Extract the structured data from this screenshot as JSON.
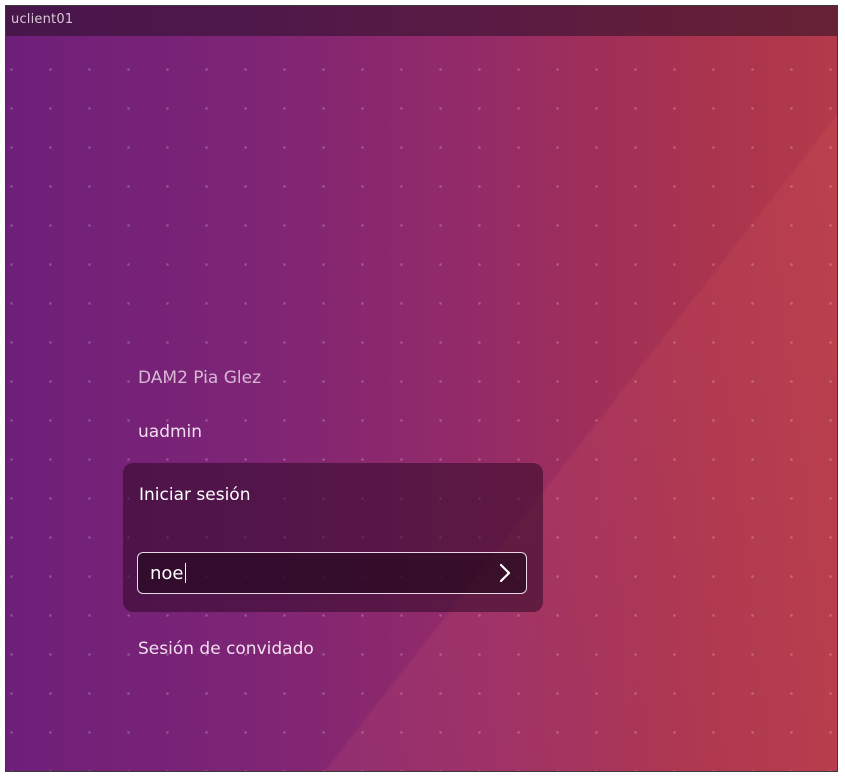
{
  "topbar": {
    "hostname": "uclient01"
  },
  "users": [
    {
      "label": "DAM2 Pia Glez"
    },
    {
      "label": "uadmin"
    }
  ],
  "login": {
    "selected_label": "Iniciar sesión",
    "password_value": "noe",
    "submit_icon": "chevron-right-icon"
  },
  "guest": {
    "label": "Sesión de convidado"
  },
  "colors": {
    "background_left": "#6e1f79",
    "background_right": "#b33a4a",
    "panel": "#2d0a26"
  }
}
